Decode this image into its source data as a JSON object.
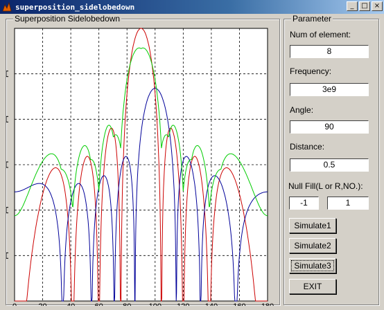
{
  "window": {
    "title": "superposition_sidelobedown",
    "buttons": [
      "_",
      "□",
      "×"
    ]
  },
  "plot_panel": {
    "title": "Superposition Sidelobedown"
  },
  "parameter": {
    "title": "Parameter",
    "num_label": "Num of element:",
    "num_value": "8",
    "freq_label": "Frequency:",
    "freq_value": "3e9",
    "angle_label": "Angle:",
    "angle_value": "90",
    "dist_label": "Distance:",
    "dist_value": "0.5",
    "null_label": "Null Fill(L or R,NO.):",
    "null_lr": "-1",
    "null_no": "1",
    "sim1": "Simulate1",
    "sim2": "Simulate2",
    "sim3": "Simulate3",
    "exit": "EXIT"
  },
  "chart_data": {
    "type": "line",
    "xlim": [
      0,
      180
    ],
    "x_ticks": [
      "0",
      "20",
      "40",
      "60",
      "80",
      "100",
      "120",
      "140",
      "160",
      "180"
    ],
    "grid": true,
    "series": [
      {
        "color": "#cc0000",
        "n": 8,
        "beam_deg": 90,
        "shift_deg": 0
      },
      {
        "color": "#000099",
        "n": 8,
        "beam_deg": 100,
        "shift_deg": 10
      },
      {
        "color": "#00cc00",
        "n": 8,
        "beam_deg": 90,
        "shift_deg": 0,
        "fill": true
      }
    ]
  }
}
